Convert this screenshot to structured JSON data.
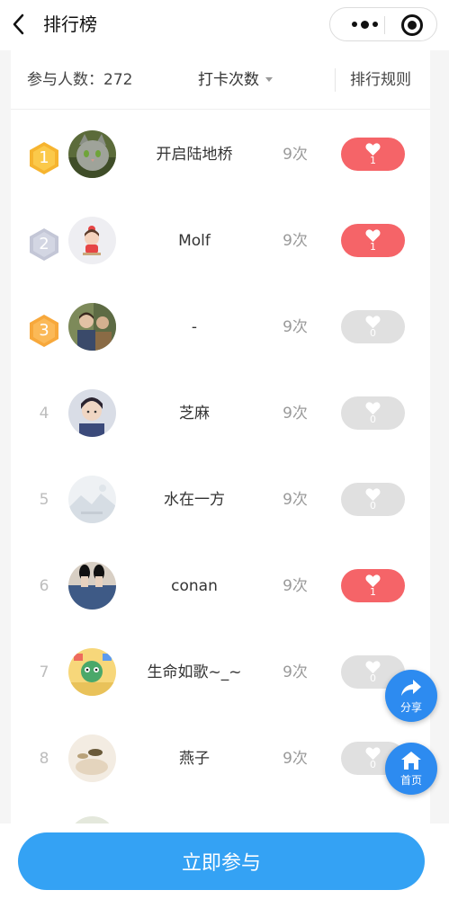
{
  "nav": {
    "title": "排行榜"
  },
  "stats": {
    "participants": "参与人数：272",
    "sort_label": "打卡次数",
    "rules_label": "排行规则"
  },
  "rows": [
    {
      "rank": "1",
      "name": "开启陆地桥",
      "count": "9次",
      "likes": "1",
      "liked": true,
      "avatar": "cat-avatar"
    },
    {
      "rank": "2",
      "name": "Molf",
      "count": "9次",
      "likes": "1",
      "liked": true,
      "avatar": "cartoon-girl-avatar"
    },
    {
      "rank": "3",
      "name": "-",
      "count": "9次",
      "likes": "0",
      "liked": false,
      "avatar": "photo-avatar"
    },
    {
      "rank": "4",
      "name": "芝麻",
      "count": "9次",
      "likes": "0",
      "liked": false,
      "avatar": "portrait-avatar"
    },
    {
      "rank": "5",
      "name": "水在一方",
      "count": "9次",
      "likes": "0",
      "liked": false,
      "avatar": "default-avatar"
    },
    {
      "rank": "6",
      "name": "conan",
      "count": "9次",
      "likes": "1",
      "liked": true,
      "avatar": "shoes-avatar"
    },
    {
      "rank": "7",
      "name": "生命如歌~_~",
      "count": "9次",
      "likes": "0",
      "liked": false,
      "avatar": "cartoon-avatar"
    },
    {
      "rank": "8",
      "name": "燕子",
      "count": "9次",
      "likes": "0",
      "liked": false,
      "avatar": "still-life-avatar"
    }
  ],
  "fabs": {
    "share_label": "分享",
    "home_label": "首页"
  },
  "footer": {
    "join_label": "立即参与"
  },
  "colors": {
    "like_active": "#f56468",
    "like_inactive": "#e0e0e0",
    "accent": "#34a2f4",
    "gold": "#f6b42f",
    "silver": "#c3c6d6",
    "bronze": "#f7a83b"
  }
}
